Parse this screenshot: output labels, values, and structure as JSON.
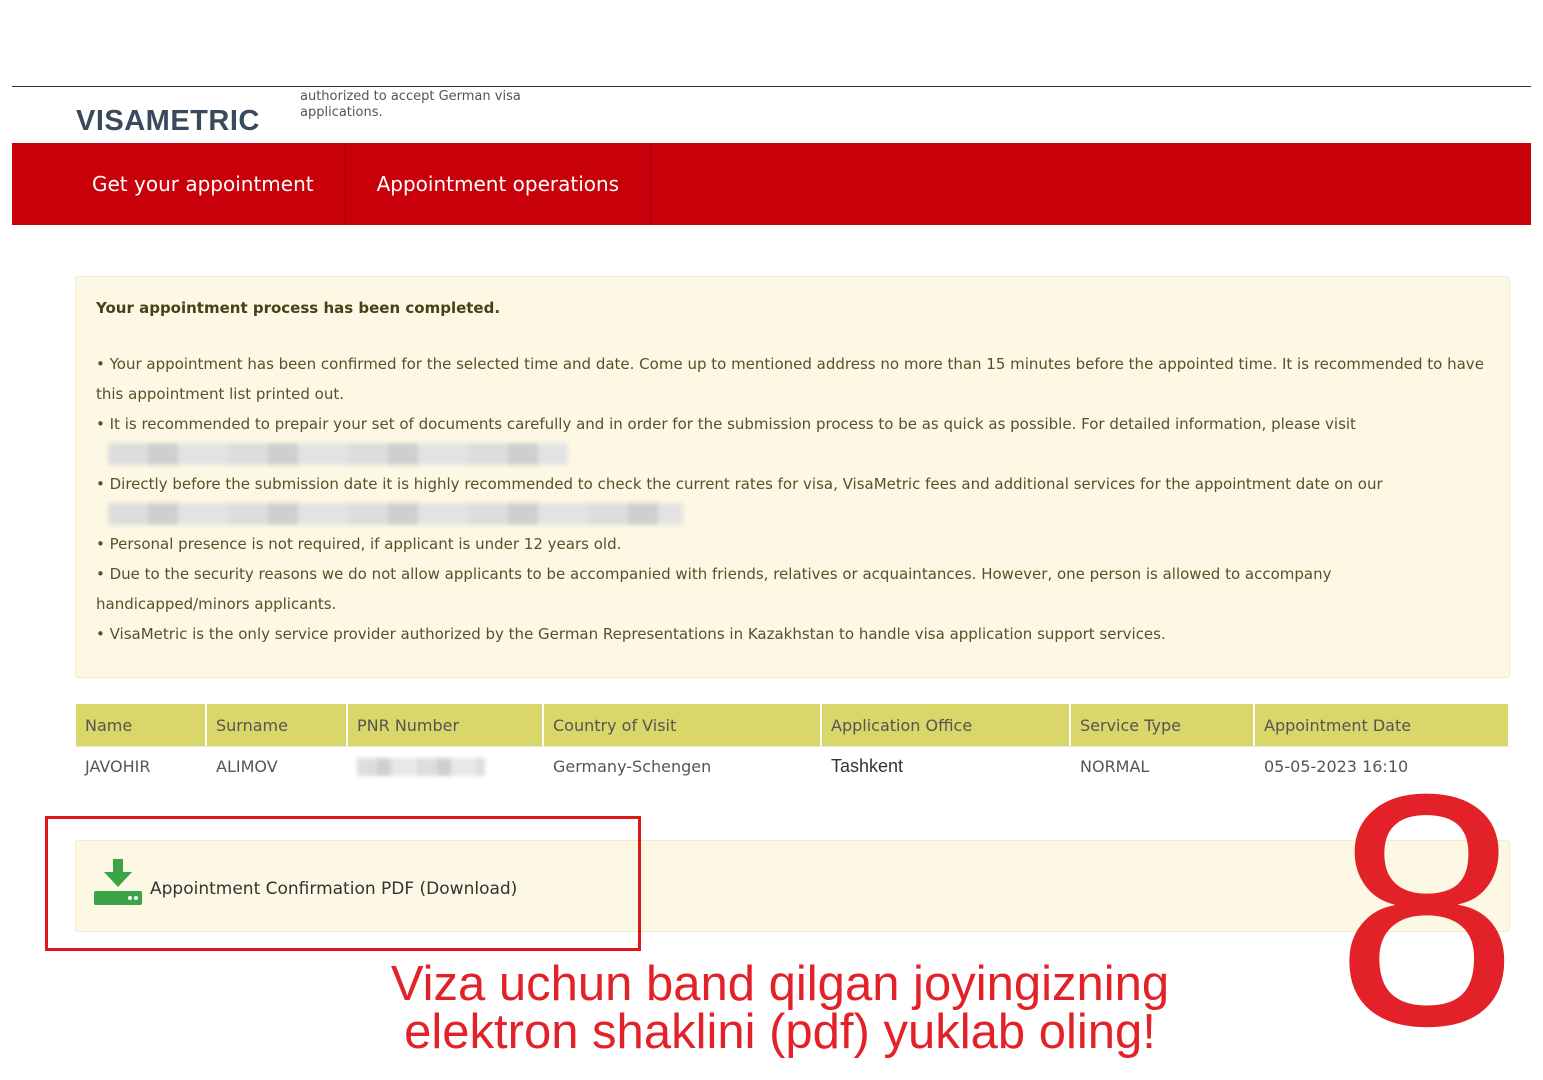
{
  "header": {
    "logo": "VISAMETRIC",
    "tagline": "authorized to accept German visa applications."
  },
  "nav": {
    "items": [
      {
        "label": "Get your appointment"
      },
      {
        "label": "Appointment operations"
      }
    ]
  },
  "alert": {
    "title": "Your appointment process has been completed.",
    "lines": [
      "• Your appointment has been confirmed for the selected time and date. Come up to mentioned address no more than 15 minutes before the appointed time. It is recommended to have this appointment list printed out.",
      "• It is recommended to prepair your set of documents carefully and in order for the submission process to be as quick as possible. For detailed information, please visit",
      "• Directly before the submission date it is highly recommended to check the current rates for visa, VisaMetric fees and additional services for the appointment date on our",
      "• Personal presence is not required, if applicant is under 12 years old.",
      "• Due to the security reasons we do not allow applicants to be accompanied with friends, relatives or acquaintances. However, one person is allowed to accompany handicapped/minors applicants.",
      "• VisaMetric is the only service provider authorized by the German Representations in Kazakhstan to handle visa application support services."
    ]
  },
  "table": {
    "headers": [
      "Name",
      "Surname",
      "PNR Number",
      "Country of Visit",
      "Application Office",
      "Service Type",
      "Appointment Date"
    ],
    "row": {
      "name": "JAVOHIR",
      "surname": "ALIMOV",
      "country": "Germany-Schengen",
      "office": "Tashkent",
      "service": "NORMAL",
      "date": "05-05-2023 16:10"
    }
  },
  "download": {
    "label": "Appointment Confirmation PDF (Download)",
    "icon": "download-icon",
    "icon_color": "#3aa447"
  },
  "annotation": {
    "number": "8",
    "caption_line1": "Viza uchun band qilgan joyingizning",
    "caption_line2": "elektron shaklini (pdf) yuklab oling!",
    "color": "#e32128"
  },
  "colors": {
    "brand_red": "#c8000a",
    "alert_bg": "#fcf8e3",
    "table_header_bg": "#d9d66a"
  }
}
